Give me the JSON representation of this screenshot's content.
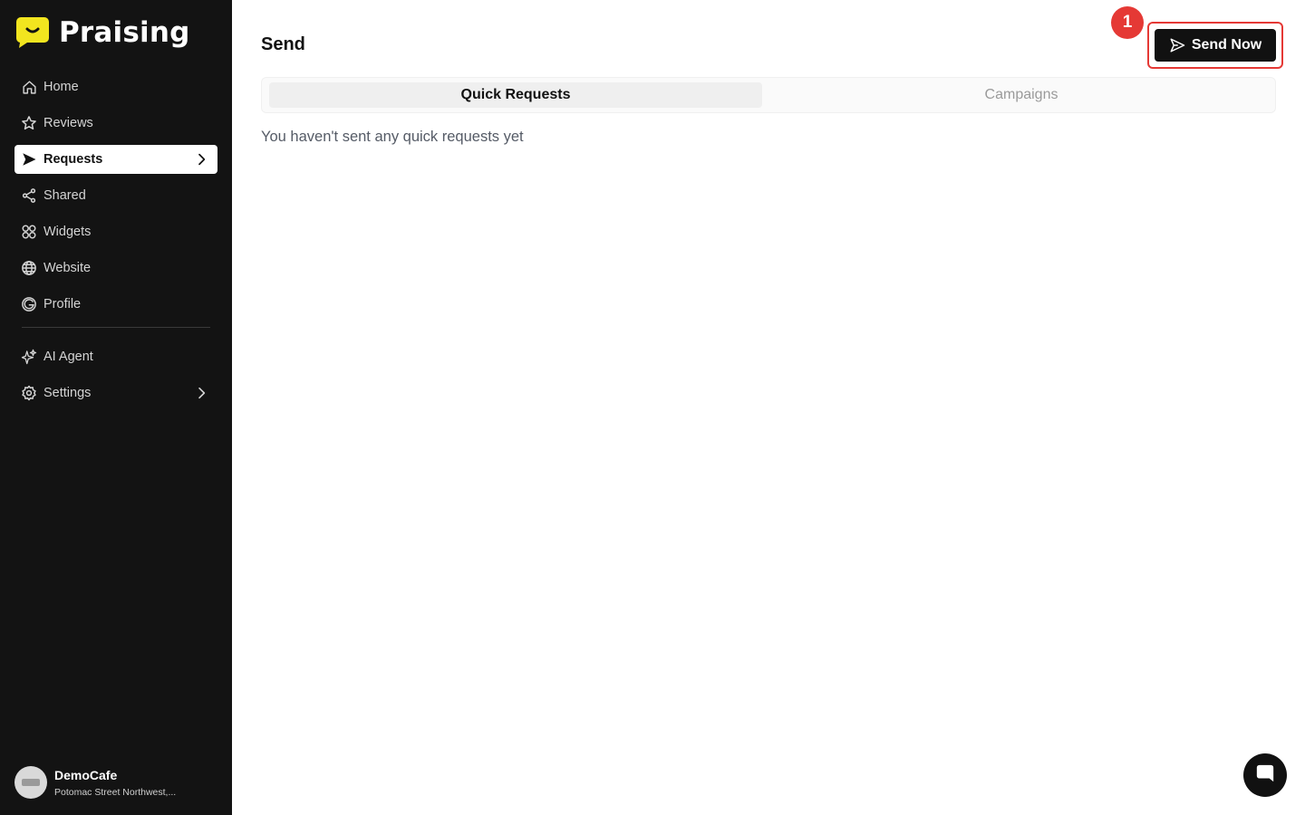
{
  "brand": {
    "name": "Praising",
    "accent": "#f2e51f"
  },
  "sidebar": {
    "items": [
      {
        "label": "Home",
        "icon": "home-icon"
      },
      {
        "label": "Reviews",
        "icon": "star-icon"
      },
      {
        "label": "Requests",
        "icon": "send-icon",
        "active": true
      },
      {
        "label": "Shared",
        "icon": "share-icon"
      },
      {
        "label": "Widgets",
        "icon": "widgets-icon"
      },
      {
        "label": "Website",
        "icon": "globe-icon"
      },
      {
        "label": "Profile",
        "icon": "google-icon"
      },
      {
        "label": "AI Agent",
        "icon": "sparkle-icon"
      },
      {
        "label": "Settings",
        "icon": "gear-icon"
      }
    ]
  },
  "account": {
    "name": "DemoCafe",
    "address": "Potomac Street Northwest,..."
  },
  "header": {
    "title": "Send",
    "send_now_label": "Send Now",
    "step_badge": "1"
  },
  "tabs": {
    "quick": "Quick Requests",
    "campaigns": "Campaigns"
  },
  "empty_state": {
    "message": "You haven't sent any quick requests yet"
  },
  "colors": {
    "sidebar_bg": "#131313",
    "highlight": "#e53935",
    "button_bg": "#111111"
  }
}
